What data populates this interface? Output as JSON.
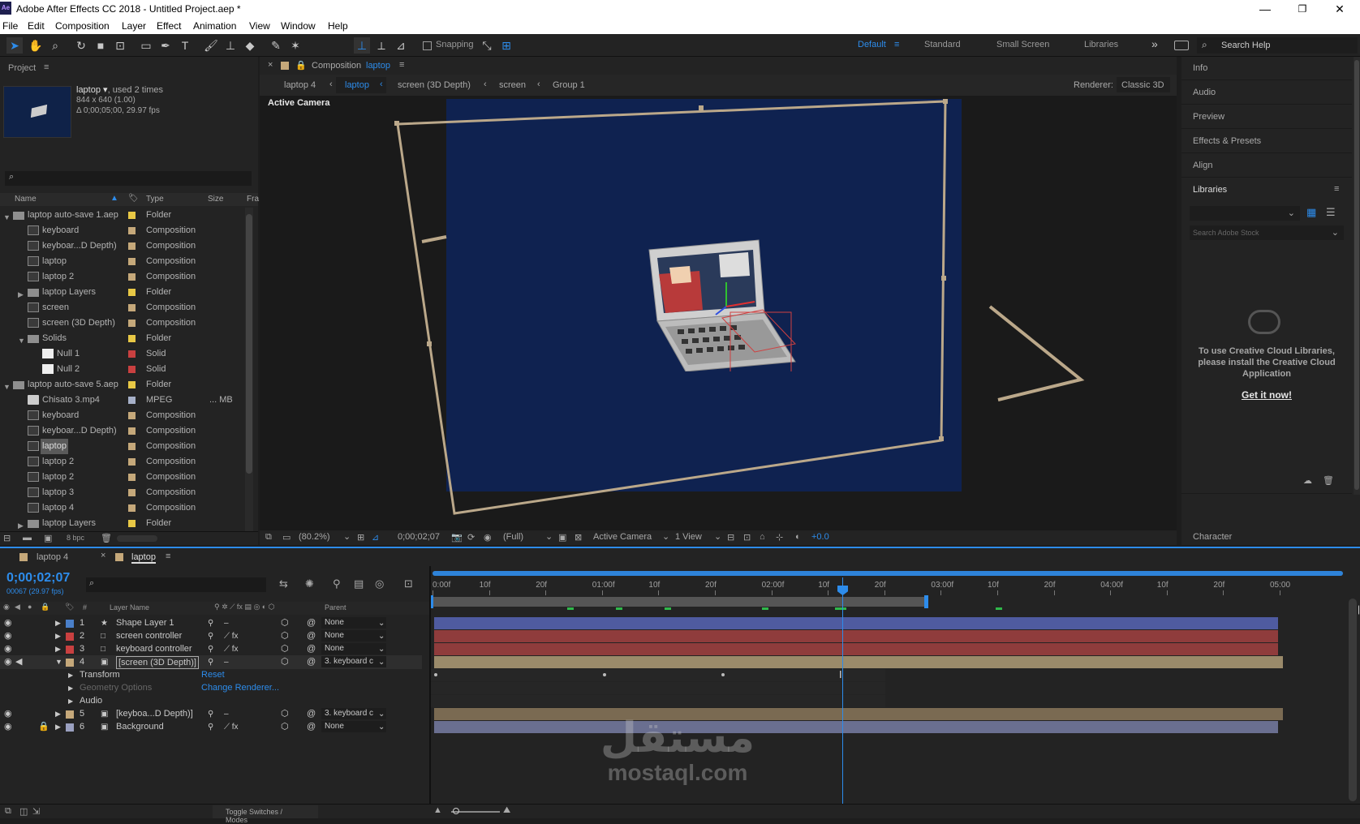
{
  "window": {
    "title": "Adobe After Effects CC 2018 - Untitled Project.aep *",
    "minimize": "—",
    "maximize": "❐",
    "close": "✕",
    "logo": "Ae"
  },
  "menu": [
    "File",
    "Edit",
    "Composition",
    "Layer",
    "Effect",
    "Animation",
    "View",
    "Window",
    "Help"
  ],
  "toolbar": {
    "snapping": "Snapping",
    "workspaces": [
      "Default",
      "Standard",
      "Small Screen",
      "Libraries"
    ],
    "active_workspace": "Default",
    "search_placeholder": "Search Help",
    "more": "»"
  },
  "project": {
    "tab": "Project",
    "item_name": "laptop",
    "item_used": ", used 2 times",
    "item_dims": "844 x 640 (1.00)",
    "item_duration": "Δ 0;00;05;00, 29.97 fps",
    "columns": {
      "name": "Name",
      "type": "Type",
      "size": "Size",
      "fr": "Fra"
    },
    "rows": [
      {
        "indent": 0,
        "tw": "▼",
        "icon": "folder",
        "name": "laptop auto-save 1.aep",
        "label": "#e8c845",
        "type": "Folder",
        "size": ""
      },
      {
        "indent": 1,
        "tw": "",
        "icon": "comp",
        "name": "keyboard",
        "label": "#c5a87a",
        "type": "Composition",
        "size": ""
      },
      {
        "indent": 1,
        "tw": "",
        "icon": "comp",
        "name": "keyboar...D Depth)",
        "label": "#c5a87a",
        "type": "Composition",
        "size": ""
      },
      {
        "indent": 1,
        "tw": "",
        "icon": "comp",
        "name": "laptop",
        "label": "#c5a87a",
        "type": "Composition",
        "size": ""
      },
      {
        "indent": 1,
        "tw": "",
        "icon": "comp",
        "name": "laptop 2",
        "label": "#c5a87a",
        "type": "Composition",
        "size": ""
      },
      {
        "indent": 1,
        "tw": "▶",
        "icon": "folder",
        "name": "laptop Layers",
        "label": "#e8c845",
        "type": "Folder",
        "size": ""
      },
      {
        "indent": 1,
        "tw": "",
        "icon": "comp",
        "name": "screen",
        "label": "#c5a87a",
        "type": "Composition",
        "size": ""
      },
      {
        "indent": 1,
        "tw": "",
        "icon": "comp",
        "name": "screen (3D Depth)",
        "label": "#c5a87a",
        "type": "Composition",
        "size": ""
      },
      {
        "indent": 1,
        "tw": "▼",
        "icon": "folder",
        "name": "Solids",
        "label": "#e8c845",
        "type": "Folder",
        "size": ""
      },
      {
        "indent": 2,
        "tw": "",
        "icon": "solid",
        "name": "Null 1",
        "label": "#c94040",
        "type": "Solid",
        "size": ""
      },
      {
        "indent": 2,
        "tw": "",
        "icon": "solid",
        "name": "Null 2",
        "label": "#c94040",
        "type": "Solid",
        "size": ""
      },
      {
        "indent": 0,
        "tw": "▼",
        "icon": "folder",
        "name": "laptop auto-save 5.aep",
        "label": "#e8c845",
        "type": "Folder",
        "size": ""
      },
      {
        "indent": 1,
        "tw": "",
        "icon": "mpeg",
        "name": "Chisato 3.mp4",
        "label": "#a6b0c8",
        "type": "MPEG",
        "size": "... MB"
      },
      {
        "indent": 1,
        "tw": "",
        "icon": "comp",
        "name": "keyboard",
        "label": "#c5a87a",
        "type": "Composition",
        "size": ""
      },
      {
        "indent": 1,
        "tw": "",
        "icon": "comp",
        "name": "keyboar...D Depth)",
        "label": "#c5a87a",
        "type": "Composition",
        "size": ""
      },
      {
        "indent": 1,
        "tw": "",
        "icon": "comp",
        "name": "laptop",
        "label": "#c5a87a",
        "type": "Composition",
        "size": "",
        "selected": true
      },
      {
        "indent": 1,
        "tw": "",
        "icon": "comp",
        "name": "laptop 2",
        "label": "#c5a87a",
        "type": "Composition",
        "size": ""
      },
      {
        "indent": 1,
        "tw": "",
        "icon": "comp",
        "name": "laptop 2",
        "label": "#c5a87a",
        "type": "Composition",
        "size": ""
      },
      {
        "indent": 1,
        "tw": "",
        "icon": "comp",
        "name": "laptop 3",
        "label": "#c5a87a",
        "type": "Composition",
        "size": ""
      },
      {
        "indent": 1,
        "tw": "",
        "icon": "comp",
        "name": "laptop 4",
        "label": "#c5a87a",
        "type": "Composition",
        "size": ""
      },
      {
        "indent": 1,
        "tw": "▶",
        "icon": "folder",
        "name": "laptop Layers",
        "label": "#e8c845",
        "type": "Folder",
        "size": ""
      }
    ],
    "bpc": "8 bpc"
  },
  "composition": {
    "tab_prefix": "Composition",
    "tab_name": "laptop",
    "breadcrumbs": [
      "laptop 4",
      "laptop",
      "screen (3D Depth)",
      "screen",
      "Group 1"
    ],
    "renderer_label": "Renderer:",
    "renderer": "Classic 3D",
    "view_label": "Active Camera",
    "footer": {
      "zoom": "(80.2%)",
      "timecode": "0;00;02;07",
      "resolution": "(Full)",
      "camera": "Active Camera",
      "views": "1 View",
      "exposure": "+0.0"
    }
  },
  "right_panels": {
    "items": [
      "Info",
      "Audio",
      "Preview",
      "Effects & Presets",
      "Align"
    ],
    "libraries": "Libraries",
    "search_stock": "Search Adobe Stock",
    "cc_message": "To use Creative Cloud Libraries, please install the Creative Cloud Application",
    "get_it": "Get it now!",
    "character": "Character"
  },
  "timeline": {
    "tabs": [
      "laptop 4",
      "laptop"
    ],
    "timecode": "0;00;02;07",
    "frames": "00067 (29.97 fps)",
    "columns": {
      "num": "#",
      "layer_name": "Layer Name",
      "parent": "Parent"
    },
    "ruler": [
      "0:00f",
      "10f",
      "20f",
      "01:00f",
      "10f",
      "20f",
      "02:00f",
      "10f",
      "20f",
      "03:00f",
      "10f",
      "20f",
      "04:00f",
      "10f",
      "20f",
      "05:00"
    ],
    "layers": [
      {
        "num": "1",
        "name": "Shape Layer 1",
        "label": "#4a7fc8",
        "icon": "star",
        "parent": "None",
        "bar": "#4f5ba0",
        "fx": false
      },
      {
        "num": "2",
        "name": "screen controller",
        "label": "#c94040",
        "icon": "solid",
        "parent": "None",
        "bar": "#8f3c3c",
        "fx": true
      },
      {
        "num": "3",
        "name": "keyboard controller",
        "label": "#c94040",
        "icon": "solid",
        "parent": "None",
        "bar": "#8f3c3c",
        "fx": true
      },
      {
        "num": "4",
        "name": "[screen (3D Depth)]",
        "label": "#c5a87a",
        "icon": "comp",
        "parent": "3. keyboard c",
        "bar": "#9a8a6a",
        "fx": false,
        "selected": true
      },
      {
        "num": "5",
        "name": "[keyboa...D Depth)]",
        "label": "#c5a87a",
        "icon": "comp",
        "parent": "3. keyboard c",
        "bar": "#7a6a52",
        "fx": false
      },
      {
        "num": "6",
        "name": "Background",
        "label": "#9aa0c0",
        "icon": "comp",
        "parent": "None",
        "bar": "#6a6f90",
        "fx": true
      }
    ],
    "sub_props": [
      {
        "name": "Transform",
        "value": "Reset"
      },
      {
        "name": "Geometry Options",
        "value": "Change Renderer..."
      },
      {
        "name": "Audio",
        "value": ""
      }
    ],
    "toggle_label": "Toggle Switches / Modes"
  },
  "watermark": {
    "arabic": "مستقل",
    "latin": "mostaql.com"
  }
}
